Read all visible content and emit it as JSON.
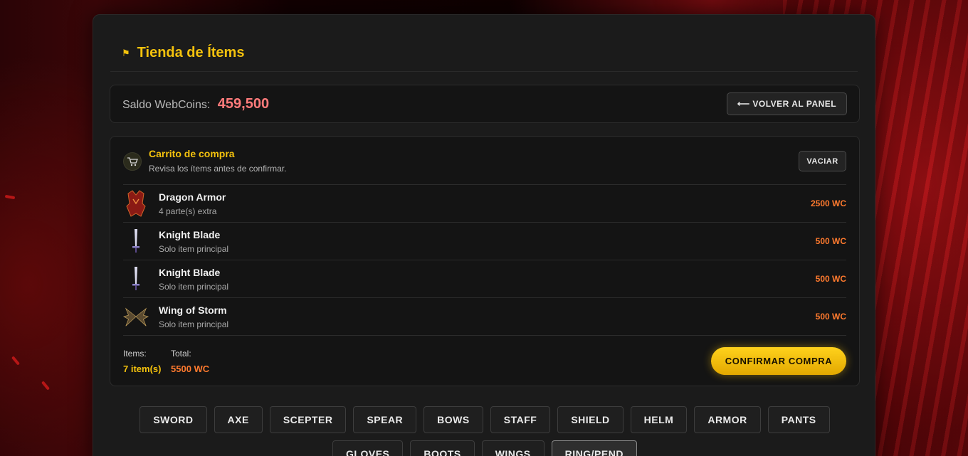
{
  "header": {
    "icon": "flag-icon",
    "title": "Tienda de Ítems"
  },
  "balance": {
    "label": "Saldo WebCoins:",
    "amount": "459,500",
    "back_button": "⟵ VOLVER AL PANEL"
  },
  "cart": {
    "title": "Carrito de compra",
    "subtitle": "Revisa los ítems antes de confirmar.",
    "empty_button": "VACIAR",
    "items": [
      {
        "name": "Dragon Armor",
        "note": "4 parte(s) extra",
        "price": "2500 WC",
        "icon": "dragon-armor-icon"
      },
      {
        "name": "Knight Blade",
        "note": "Solo item principal",
        "price": "500 WC",
        "icon": "sword-icon"
      },
      {
        "name": "Knight Blade",
        "note": "Solo item principal",
        "price": "500 WC",
        "icon": "sword-icon"
      },
      {
        "name": "Wing of Storm",
        "note": "Solo item principal",
        "price": "500 WC",
        "icon": "wings-icon"
      }
    ],
    "footer": {
      "items_label": "Items:",
      "items_value": "7 item(s)",
      "total_label": "Total:",
      "total_value": "5500 WC",
      "confirm_button": "CONFIRMAR COMPRA"
    }
  },
  "categories": {
    "row1": [
      "SWORD",
      "AXE",
      "SCEPTER",
      "SPEAR",
      "BOWS",
      "STAFF",
      "SHIELD",
      "HELM",
      "ARMOR",
      "PANTS"
    ],
    "row2": [
      "GLOVES",
      "BOOTS",
      "WINGS",
      "RING/PEND"
    ],
    "active": "RING/PEND"
  },
  "colors": {
    "accent": "#f4c20d",
    "price": "#ff7a2e",
    "balance": "#ff7b7b"
  }
}
